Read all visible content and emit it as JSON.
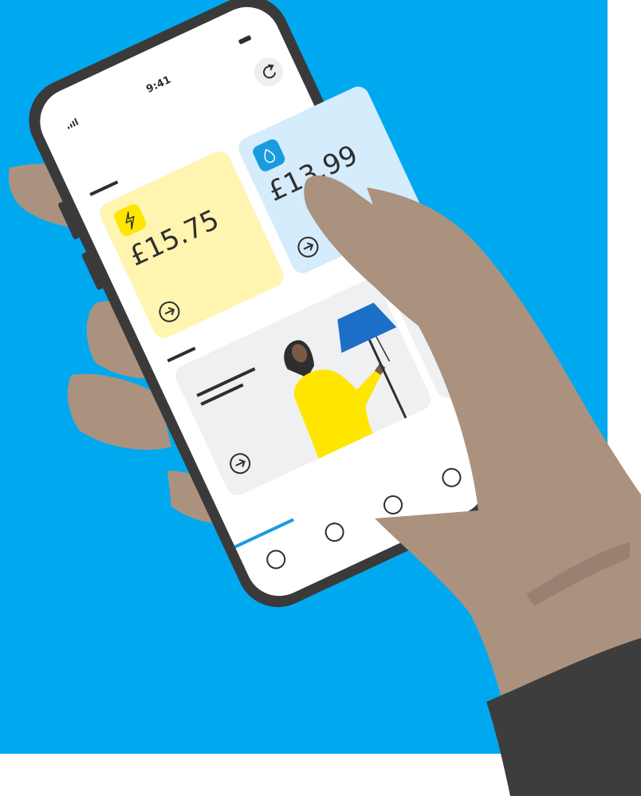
{
  "colors": {
    "background_blue": "#00a9ef",
    "phone_frame": "#3a3a3a",
    "skin": "#ab927f",
    "skin_dark": "#9a8070",
    "sleeve": "#3d3d3d",
    "electricity_card": "#fff4b0",
    "electricity_icon": "#ffe600",
    "gas_card": "#d4ecfb",
    "gas_icon": "#1a9be0",
    "illustration_card": "#eef0f2",
    "nav_accent": "#1a9be0",
    "woman_top": "#ffe600",
    "lamp_shade": "#1b6fc6"
  },
  "status_bar": {
    "time": "9:41",
    "signal_icon": "signal-icon",
    "battery_icon": "battery-icon"
  },
  "header": {
    "refresh_icon": "refresh-icon"
  },
  "cards": {
    "electricity": {
      "amount": "£15.75",
      "icon": "lightning-icon",
      "action_icon": "arrow-right-circle-icon"
    },
    "gas": {
      "amount": "£13.99",
      "icon": "flame-icon",
      "action_icon": "arrow-right-circle-icon"
    },
    "promo": {
      "illustration": "woman-with-lamp-illustration",
      "action_icon": "arrow-right-circle-icon"
    }
  },
  "bottom_nav": {
    "items": [
      "nav-item-1",
      "nav-item-2",
      "nav-item-3",
      "nav-item-4"
    ],
    "active_index": 0
  }
}
